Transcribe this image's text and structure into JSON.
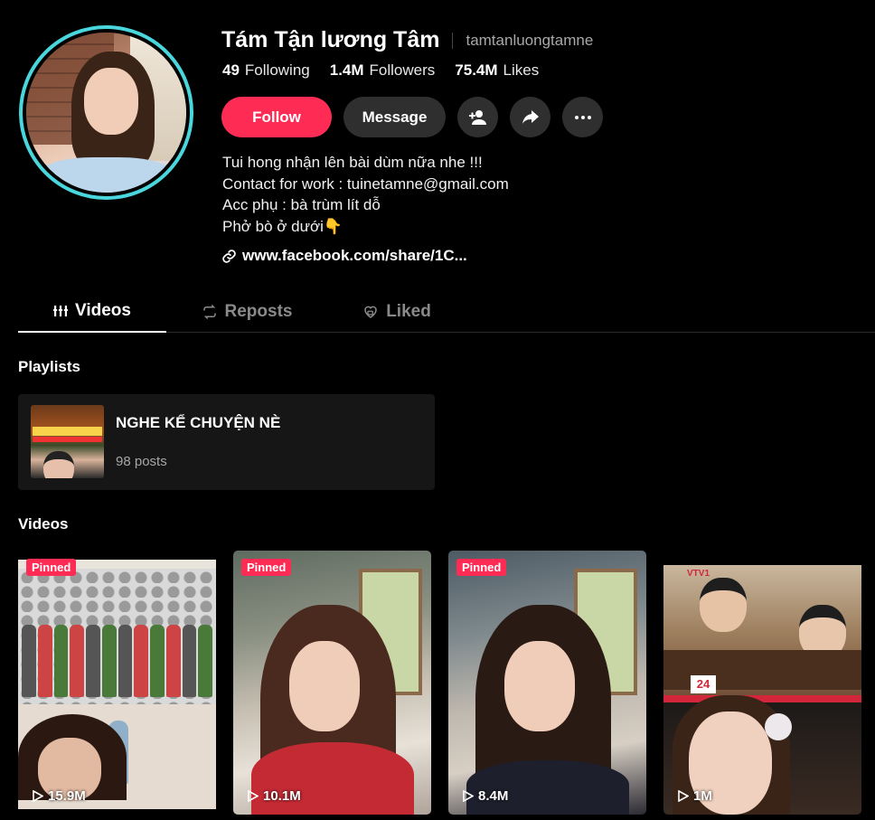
{
  "profile": {
    "display_name": "Tám Tận lương Tâm",
    "username": "tamtanluongtamne",
    "stats": {
      "following_count": "49",
      "following_label": "Following",
      "followers_count": "1.4M",
      "followers_label": "Followers",
      "likes_count": "75.4M",
      "likes_label": "Likes"
    },
    "actions": {
      "follow_label": "Follow",
      "message_label": "Message"
    },
    "bio": [
      "Tui hong nhận lên bài dùm nữa nhe !!!",
      "Contact for work : tuinetamne@gmail.com",
      "Acc phụ : bà trùm lít dỗ",
      "Phở bò ở dưới👇"
    ],
    "link": "www.facebook.com/share/1C..."
  },
  "tabs": [
    {
      "label": "Videos",
      "active": true
    },
    {
      "label": "Reposts",
      "active": false
    },
    {
      "label": "Liked",
      "active": false
    }
  ],
  "playlists_section": {
    "title": "Playlists",
    "items": [
      {
        "name": "NGHE KỂ CHUYỆN NÈ",
        "count": "98 posts"
      }
    ]
  },
  "videos_section": {
    "title": "Videos",
    "items": [
      {
        "pinned_label": "Pinned",
        "views": "15.9M"
      },
      {
        "pinned_label": "Pinned",
        "views": "10.1M"
      },
      {
        "pinned_label": "Pinned",
        "views": "8.4M"
      },
      {
        "pinned_label": "",
        "views": "1M",
        "overlay_logo": "24",
        "overlay_channel": "VTV1"
      }
    ]
  },
  "colors": {
    "accent": "#fe2c55",
    "avatar_ring": "#4ad6dd",
    "background": "#000000",
    "button_dark": "#2f2f2f"
  },
  "icons": [
    "add-friend-icon",
    "share-icon",
    "more-icon",
    "link-icon",
    "videos-grid-icon",
    "repost-icon",
    "liked-icon",
    "play-icon"
  ]
}
